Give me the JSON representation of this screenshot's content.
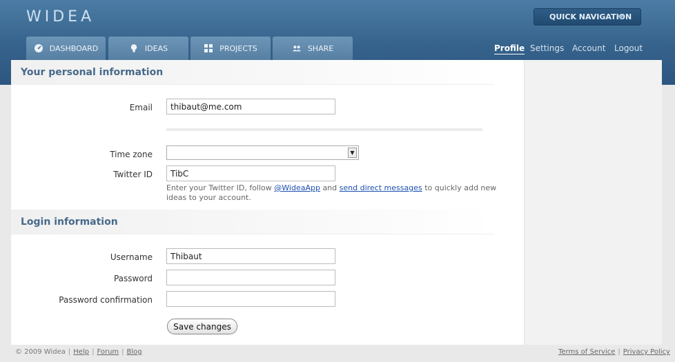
{
  "header": {
    "logo": "WIDEA",
    "quick_nav_label": "QUICK NAVIGATION",
    "tabs": [
      {
        "label": "DASHBOARD",
        "icon": "dashboard-icon"
      },
      {
        "label": "IDEAS",
        "icon": "lightbulb-icon"
      },
      {
        "label": "PROJECTS",
        "icon": "grid-icon"
      },
      {
        "label": "SHARE",
        "icon": "people-icon"
      }
    ],
    "user_links": [
      {
        "label": "Profile",
        "active": true
      },
      {
        "label": "Settings",
        "active": false
      },
      {
        "label": "Account",
        "active": false
      },
      {
        "label": "Logout",
        "active": false
      }
    ]
  },
  "personal": {
    "title": "Your personal information",
    "email_label": "Email",
    "email_value": "thibaut@me.com",
    "timezone_label": "Time zone",
    "timezone_value": "",
    "twitter_label": "Twitter ID",
    "twitter_value": "TibC",
    "twitter_help_1": "Enter your Twitter ID, follow",
    "twitter_help_link1": "@WideaApp",
    "twitter_help_2": "and",
    "twitter_help_link2": "send direct messages",
    "twitter_help_3": "to quickly add new ideas to your account."
  },
  "login": {
    "title": "Login information",
    "username_label": "Username",
    "username_value": "Thibaut",
    "password_label": "Password",
    "password_value": "",
    "confirm_label": "Password confirmation",
    "confirm_value": "",
    "save_label": "Save changes"
  },
  "footer": {
    "copyright": "© 2009 Widea",
    "links_left": [
      "Help",
      "Forum",
      "Blog"
    ],
    "links_right": [
      "Terms of Service",
      "Privacy Policy"
    ]
  },
  "colors": {
    "header_blue": "#35628b",
    "section_title": "#47698a",
    "link": "#1a4fb0"
  }
}
